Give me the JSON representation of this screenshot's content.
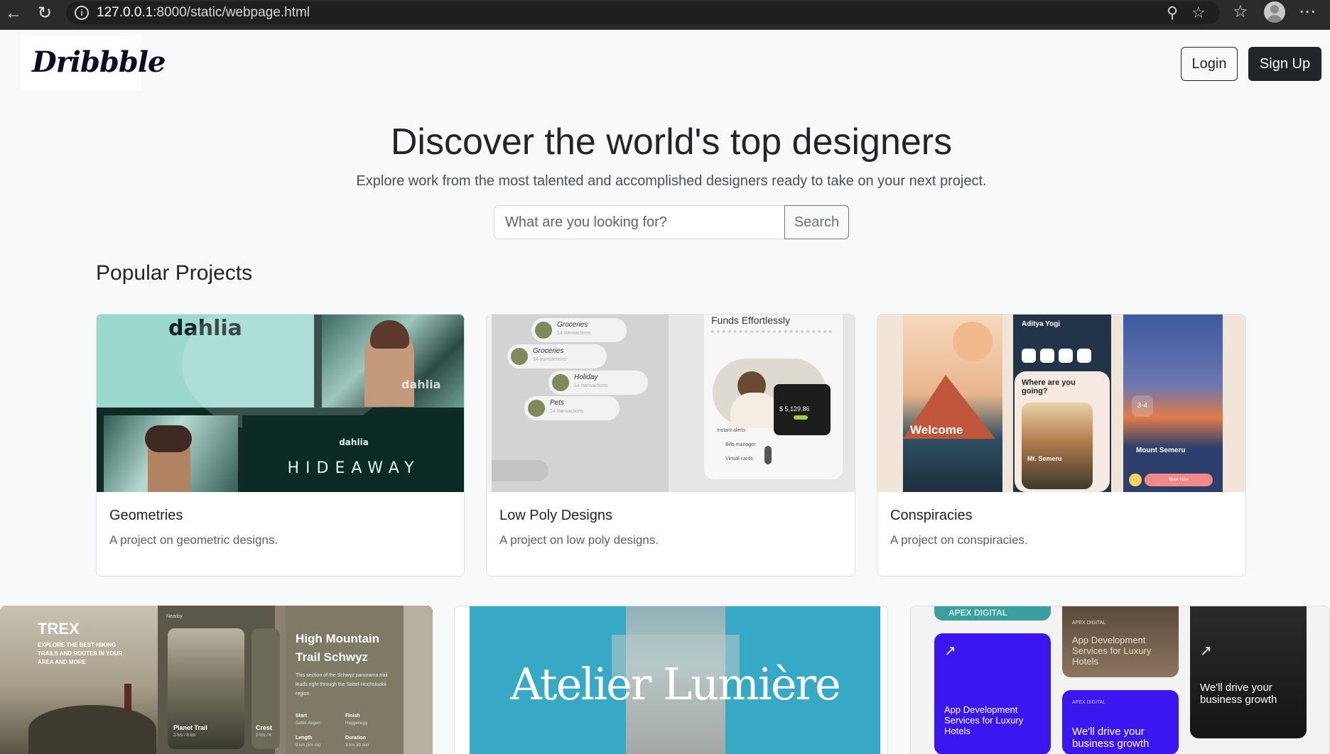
{
  "browser": {
    "url_host": "127.0.0.1",
    "url_rest": ":8000/static/webpage.html"
  },
  "header": {
    "logo": "Dribbble",
    "login_label": "Login",
    "signup_label": "Sign Up"
  },
  "hero": {
    "title": "Discover the world's top designers",
    "subtitle": "Explore work from the most talented and accomplished designers ready to take on your next project.",
    "search_placeholder": "What are you looking for?",
    "search_button": "Search"
  },
  "section_title": "Popular Projects",
  "projects": [
    {
      "title": "Geometries",
      "description": "A project on geometric designs.",
      "art": {
        "brand": "dahlia",
        "brand_sub": "HIDEAWAY"
      }
    },
    {
      "title": "Low Poly Designs",
      "description": "A project on low poly designs.",
      "art": {
        "items": [
          "Groceries",
          "Groceries",
          "Holiday",
          "Pets"
        ],
        "item_sub": "14 transactions",
        "heading": "Funds Effortlessly",
        "amount": "$ 5,129.86",
        "options": [
          "Instant alerts",
          "Bills manager",
          "Virtual cards"
        ]
      }
    },
    {
      "title": "Conspiracies",
      "description": "A project on conspiracies.",
      "art": {
        "welcome": "Welcome",
        "user": "Aditya Yogi",
        "question": "Where are you going?",
        "place": "Mt. Semeru",
        "mount": "Mount Semeru",
        "stat": "3-4",
        "cta": "Book Now"
      }
    }
  ],
  "bottom_cards": [
    {
      "art": {
        "brand": "TREX",
        "tagline": "EXPLORE THE BEST HIKING TRAILS AND ROUTES IN YOUR AREA AND MORE",
        "nearby": "Nearby",
        "trail_a": "Planet Trail",
        "trail_a_meta": "2 hrs / 8 km",
        "trail_b": "Crest",
        "trail_b_meta": "3 hrs / 4",
        "headline": "High Mountain Trail Schwyz",
        "body": "This section of the Schwyz panorama trail leads right through the Sattel-Hochstuckli region.",
        "start_label": "Start",
        "start_value": "Sattel-Aegeri",
        "finish_label": "Finish",
        "finish_value": "Haggenegg",
        "length_label": "Length",
        "length_value": "9 km (5½ mi)",
        "duration_label": "Duration",
        "duration_value": "3 hrs 30 min"
      }
    },
    {
      "art": {
        "wordmark": "Atelier Lumière"
      }
    },
    {
      "art": {
        "top": "APEX DIGITAL",
        "service": "App Development Services for Luxury Hotels",
        "label": "APEX DIGITAL",
        "drive": "We'll drive your business growth"
      }
    }
  ],
  "colors": {
    "page_bg": "#f8f9fa",
    "dark_button": "#212529",
    "atelier_bg": "#37a9c6",
    "apex_purple": "#3b16f0"
  }
}
